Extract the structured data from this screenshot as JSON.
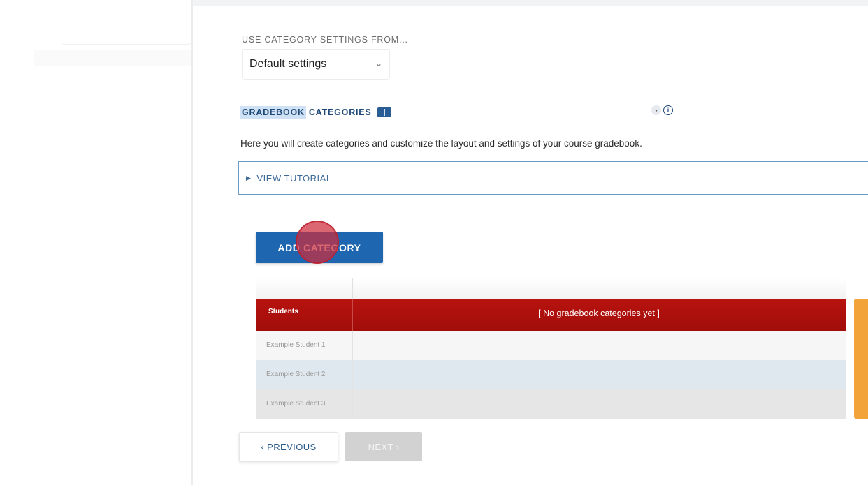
{
  "settings": {
    "label": "USE CATEGORY SETTINGS FROM...",
    "selected": "Default settings"
  },
  "section": {
    "title_highlight": "GRADEBOOK",
    "title_rest": " CATEGORIES",
    "help_arrow": "›",
    "help_info": "i",
    "intro": "Here you will create categories and customize the layout and settings of your course gradebook."
  },
  "tutorial": {
    "label": "VIEW TUTORIAL"
  },
  "actions": {
    "add_category": "ADD CATEGORY",
    "previous": "‹  PREVIOUS",
    "next": "NEXT  ›"
  },
  "table": {
    "students_header": "Students",
    "empty_message": "[ No gradebook categories yet ]",
    "rows": [
      "Example Student 1",
      "Example Student 2",
      "Example Student 3"
    ]
  },
  "colors": {
    "header_red": "#b8130f",
    "primary_blue": "#1f66b0",
    "accent_orange": "#f2a33a",
    "click_indicator": "#cd2d3c"
  }
}
